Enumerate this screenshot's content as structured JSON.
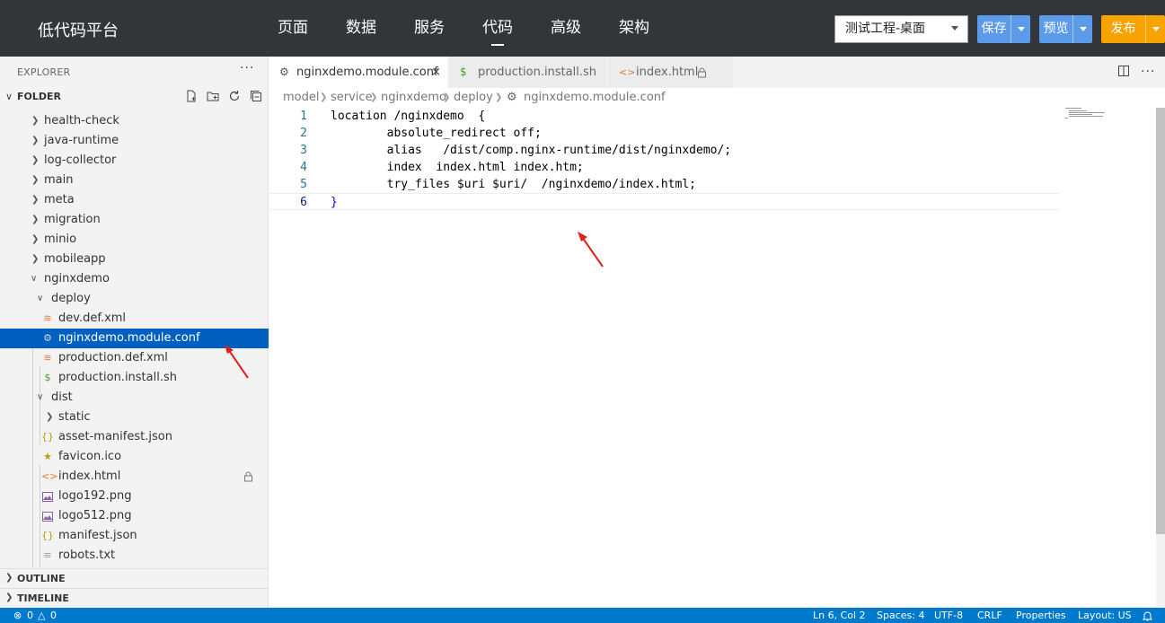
{
  "header": {
    "brand": "低代码平台",
    "nav": [
      "页面",
      "数据",
      "服务",
      "代码",
      "高级",
      "架构"
    ],
    "active_nav_index": 3,
    "project_select": "测试工程-桌面",
    "save_label": "保存",
    "preview_label": "预览",
    "publish_label": "发布",
    "colors": {
      "bar": "#333639",
      "save": "#5b9bea",
      "publish": "#f7a400"
    }
  },
  "sidebar": {
    "explorer_title": "EXPLORER",
    "more_icon": "ellipsis-icon",
    "folder_title": "FOLDER",
    "folder_actions": [
      "new-file-icon",
      "new-folder-icon",
      "refresh-icon",
      "collapse-all-icon"
    ],
    "tree": [
      {
        "label": "health-check",
        "type": "folder",
        "depth": 1,
        "expanded": false
      },
      {
        "label": "java-runtime",
        "type": "folder",
        "depth": 1,
        "expanded": false
      },
      {
        "label": "log-collector",
        "type": "folder",
        "depth": 1,
        "expanded": false
      },
      {
        "label": "main",
        "type": "folder",
        "depth": 1,
        "expanded": false
      },
      {
        "label": "meta",
        "type": "folder",
        "depth": 1,
        "expanded": false
      },
      {
        "label": "migration",
        "type": "folder",
        "depth": 1,
        "expanded": false
      },
      {
        "label": "minio",
        "type": "folder",
        "depth": 1,
        "expanded": false
      },
      {
        "label": "mobileapp",
        "type": "folder",
        "depth": 1,
        "expanded": false
      },
      {
        "label": "nginxdemo",
        "type": "folder",
        "depth": 1,
        "expanded": true
      },
      {
        "label": "deploy",
        "type": "folder",
        "depth": 2,
        "expanded": true
      },
      {
        "label": "dev.def.xml",
        "type": "file",
        "depth": 3,
        "icon": "rss-icon"
      },
      {
        "label": "nginxdemo.module.conf",
        "type": "file",
        "depth": 3,
        "icon": "gear-icon",
        "selected": true
      },
      {
        "label": "production.def.xml",
        "type": "file",
        "depth": 3,
        "icon": "rss-icon"
      },
      {
        "label": "production.install.sh",
        "type": "file",
        "depth": 3,
        "icon": "dollar-icon"
      },
      {
        "label": "dist",
        "type": "folder",
        "depth": 2,
        "expanded": true
      },
      {
        "label": "static",
        "type": "folder",
        "depth": 3,
        "expanded": false
      },
      {
        "label": "asset-manifest.json",
        "type": "file",
        "depth": 3,
        "icon": "json-braces-icon"
      },
      {
        "label": "favicon.ico",
        "type": "file",
        "depth": 3,
        "icon": "star-icon"
      },
      {
        "label": "index.html",
        "type": "file",
        "depth": 3,
        "icon": "html-icon",
        "locked": true
      },
      {
        "label": "logo192.png",
        "type": "file",
        "depth": 3,
        "icon": "image-icon"
      },
      {
        "label": "logo512.png",
        "type": "file",
        "depth": 3,
        "icon": "image-icon"
      },
      {
        "label": "manifest.json",
        "type": "file",
        "depth": 3,
        "icon": "json-braces-icon"
      },
      {
        "label": "robots.txt",
        "type": "file",
        "depth": 3,
        "icon": "text-lines-icon"
      }
    ],
    "outline_title": "OUTLINE",
    "timeline_title": "TIMELINE"
  },
  "editor": {
    "tabs": [
      {
        "label": "nginxdemo.module.conf",
        "icon": "gear-icon",
        "active": true,
        "closable": true
      },
      {
        "label": "production.install.sh",
        "icon": "dollar-icon",
        "active": false
      },
      {
        "label": "index.html",
        "icon": "html-icon",
        "active": false,
        "locked": true
      }
    ],
    "tab_actions": [
      "split-editor-icon",
      "more-actions-icon"
    ],
    "breadcrumb": [
      "model",
      "service",
      "nginxdemo",
      "deploy",
      "nginxdemo.module.conf"
    ],
    "lines": [
      {
        "num": "1",
        "text": "location /nginxdemo  {"
      },
      {
        "num": "2",
        "text": "        absolute_redirect off;"
      },
      {
        "num": "3",
        "text": "        alias   /dist/comp.nginx-runtime/dist/nginxdemo/;"
      },
      {
        "num": "4",
        "text": "        index  index.html index.htm;"
      },
      {
        "num": "5",
        "text": "        try_files $uri $uri/  /nginxdemo/index.html;"
      },
      {
        "num": "6",
        "text": "}"
      }
    ],
    "current_line": 6
  },
  "status": {
    "errors": "0",
    "warnings": "0",
    "position": "Ln 6, Col 2",
    "spaces": "Spaces: 4",
    "encoding": "UTF-8",
    "eol": "CRLF",
    "language": "Properties",
    "layout": "Layout: US",
    "color": "#007acc"
  }
}
